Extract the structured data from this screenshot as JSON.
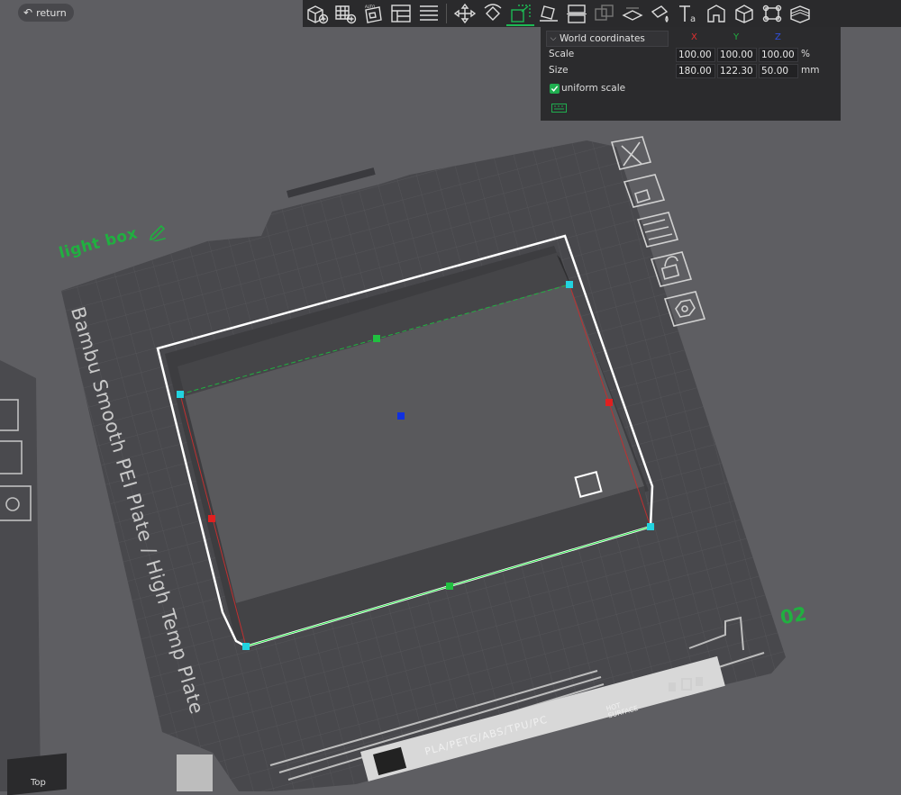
{
  "return_button": {
    "label": "return",
    "icon": "undo-arrow-icon"
  },
  "toolbar": {
    "buttons": [
      {
        "name": "add-object-icon"
      },
      {
        "name": "add-plate-icon"
      },
      {
        "name": "auto-orient-icon"
      },
      {
        "name": "arrange-icon"
      },
      {
        "name": "split-layout-icon"
      },
      {
        "name": "move-icon"
      },
      {
        "name": "rotate-icon"
      },
      {
        "name": "scale-icon"
      },
      {
        "name": "lay-on-face-icon"
      },
      {
        "name": "cut-icon"
      },
      {
        "name": "mesh-boolean-icon"
      },
      {
        "name": "support-paint-icon"
      },
      {
        "name": "seam-paint-icon"
      },
      {
        "name": "text-emboss-icon"
      },
      {
        "name": "assembly-icon"
      },
      {
        "name": "measure-icon"
      },
      {
        "name": "brim-ears-icon"
      },
      {
        "name": "variable-layer-icon"
      }
    ]
  },
  "scale_panel": {
    "coord_system": "World coordinates",
    "axes": {
      "x": "X",
      "y": "Y",
      "z": "Z"
    },
    "axis_colors": {
      "x": "#e03030",
      "y": "#20b040",
      "z": "#3050e0"
    },
    "scale": {
      "label": "Scale",
      "x": "100.00",
      "y": "100.00",
      "z": "100.00",
      "unit": "%"
    },
    "size": {
      "label": "Size",
      "x": "180.00",
      "y": "122.30",
      "z": "50.00",
      "unit": "mm"
    },
    "uniform_scale": {
      "label": "uniform scale",
      "checked": true
    }
  },
  "plate": {
    "label": "Bambu Smooth PEI Plate / High Temp Plate",
    "number": "02",
    "materials": "PLA/PETG/ABS/TPU/PC",
    "hot_line1": "HOT",
    "hot_line2": "SURFACE"
  },
  "object": {
    "name": "light box"
  },
  "plate_icons": [
    "close-icon",
    "auto-orient-icon",
    "arrange-icon",
    "lock-icon",
    "settings-icon"
  ],
  "view": {
    "top_label": "Top"
  },
  "colors": {
    "accent": "#20b040",
    "handle_cyan": "#22d3e0",
    "handle_red": "#e02020",
    "handle_blue": "#1030e0"
  }
}
